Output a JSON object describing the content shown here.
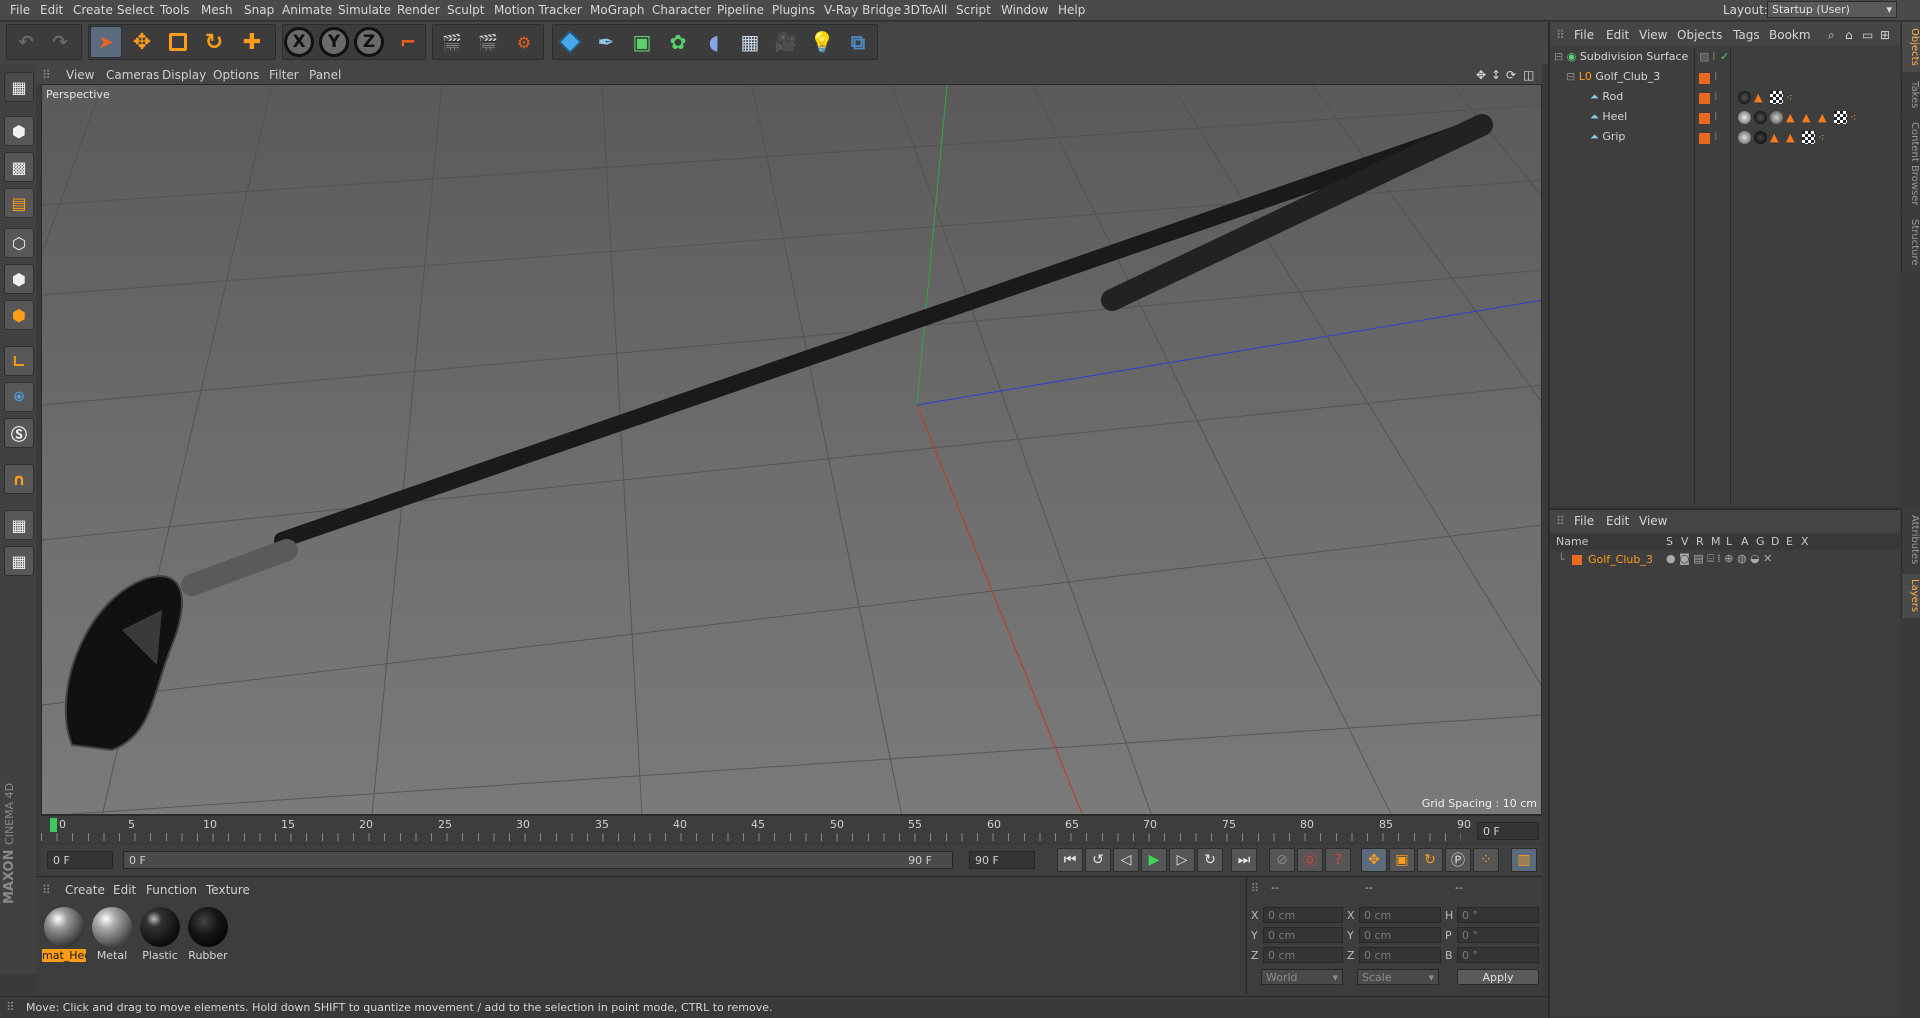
{
  "menubar": {
    "items": [
      "File",
      "Edit",
      "Create",
      "Select",
      "Tools",
      "Mesh",
      "Snap",
      "Animate",
      "Simulate",
      "Render",
      "Sculpt",
      "Motion Tracker",
      "MoGraph",
      "Character",
      "Pipeline",
      "Plugins",
      "V-Ray Bridge",
      "3DToAll",
      "Script",
      "Window",
      "Help"
    ],
    "layout_label": "Layout:",
    "layout_value": "Startup (User)"
  },
  "toolbar": {
    "icons": [
      "undo-icon",
      "redo-icon",
      "select-arrow-icon",
      "move-icon",
      "scale-icon",
      "rotate-icon",
      "last-tool-icon",
      "x-axis-icon",
      "y-axis-icon",
      "z-axis-icon",
      "coordinate-system-icon",
      "render-view-icon",
      "render-picture-viewer-icon",
      "render-settings-icon",
      "cube-icon",
      "pen-spline-icon",
      "subdivision-icon",
      "cloner-icon",
      "deformer-icon",
      "floor-icon",
      "camera-icon",
      "light-icon",
      "python-icon"
    ],
    "axis_labels": [
      "X",
      "Y",
      "Z"
    ]
  },
  "lefttools": [
    "make-editable-icon",
    "model-mode-icon",
    "texture-mode-icon",
    "workplane-icon",
    "points-mode-icon",
    "edges-mode-icon",
    "polygons-mode-icon",
    "axis-mode-icon",
    "tweak-icon",
    "snap-s-icon",
    "magnet-icon",
    "lock-grid-icon",
    "locked-workplane-icon"
  ],
  "viewport": {
    "menu": [
      "View",
      "Cameras",
      "Display",
      "Options",
      "Filter",
      "Panel"
    ],
    "camera_label": "Perspective",
    "grid_spacing": "Grid Spacing : 10 cm"
  },
  "timeline": {
    "ticks": [
      "0",
      "5",
      "10",
      "15",
      "20",
      "25",
      "30",
      "35",
      "40",
      "45",
      "50",
      "55",
      "60",
      "65",
      "70",
      "75",
      "80",
      "85",
      "90"
    ],
    "current_frame": "0 F"
  },
  "transport": {
    "start_field": "0 F",
    "range_start": "0 F",
    "range_end": "90 F",
    "end_field": "90 F"
  },
  "materials": {
    "menu": [
      "Create",
      "Edit",
      "Function",
      "Texture"
    ],
    "items": [
      {
        "name": "mat_Heel",
        "selected": true,
        "color": "#8a8a8a"
      },
      {
        "name": "Metal",
        "selected": false,
        "color": "#9a9a9a"
      },
      {
        "name": "Plastic",
        "selected": false,
        "color": "#1a1a1a"
      },
      {
        "name": "Rubber",
        "selected": false,
        "color": "#0e0e0e"
      }
    ]
  },
  "coordinates": {
    "header": [
      "--",
      "--",
      "--"
    ],
    "rows": [
      {
        "a": "X",
        "av": "0 cm",
        "b": "X",
        "bv": "0 cm",
        "c": "H",
        "cv": "0 °"
      },
      {
        "a": "Y",
        "av": "0 cm",
        "b": "Y",
        "bv": "0 cm",
        "c": "P",
        "cv": "0 °"
      },
      {
        "a": "Z",
        "av": "0 cm",
        "b": "Z",
        "bv": "0 cm",
        "c": "B",
        "cv": "0 °"
      }
    ],
    "space": "World",
    "mode": "Scale",
    "apply": "Apply"
  },
  "status": "Move: Click and drag to move elements. Hold down SHIFT to quantize movement / add to the selection in point mode, CTRL to remove.",
  "object_manager": {
    "menu": [
      "File",
      "Edit",
      "View",
      "Objects",
      "Tags",
      "Bookm"
    ],
    "objects": [
      {
        "name": "Subdivision Surface",
        "indent": 0,
        "color": "#c8c8c8"
      },
      {
        "name": "Golf_Club_3",
        "indent": 1,
        "color": "#c8c8c8"
      },
      {
        "name": "Rod",
        "indent": 2,
        "color": "#c8c8c8"
      },
      {
        "name": "Heel",
        "indent": 2,
        "color": "#c8c8c8"
      },
      {
        "name": "Grip",
        "indent": 2,
        "color": "#c8c8c8"
      }
    ]
  },
  "layer_manager": {
    "menu": [
      "File",
      "Edit",
      "View"
    ],
    "columns": [
      "Name",
      "S",
      "V",
      "R",
      "M",
      "L",
      "A",
      "G",
      "D",
      "E",
      "X"
    ],
    "layers": [
      {
        "name": "Golf_Club_3",
        "color": "#ff8c00"
      }
    ]
  },
  "side_tabs": [
    "Objects",
    "Takes",
    "Content Browser",
    "Structure",
    "Attributes",
    "Layers"
  ],
  "brand": [
    "MAXON",
    "CINEMA 4D"
  ],
  "colors": {
    "accent": "#ff8c00",
    "axis_x": "#c0392b",
    "axis_y": "#27ae60",
    "axis_z": "#2c3fd0"
  }
}
